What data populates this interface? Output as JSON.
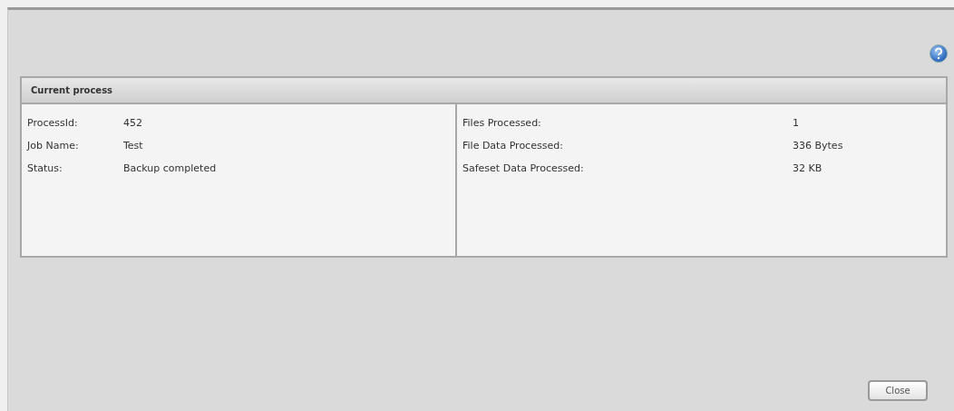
{
  "panel": {
    "title": "Current process",
    "left_fields": [
      {
        "label": "ProcessId:",
        "value": "452"
      },
      {
        "label": "Job Name:",
        "value": "Test"
      },
      {
        "label": "Status:",
        "value": "Backup completed"
      }
    ],
    "right_fields": [
      {
        "label": "Files Processed:",
        "value": "1"
      },
      {
        "label": "File Data Processed:",
        "value": "336 Bytes"
      },
      {
        "label": "Safeset Data Processed:",
        "value": "32 KB"
      }
    ]
  },
  "buttons": [
    "Close"
  ]
}
